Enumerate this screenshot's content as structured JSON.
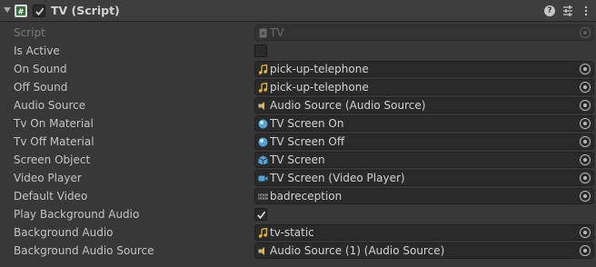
{
  "header": {
    "title": "TV (Script)",
    "enabled": true
  },
  "colors": {
    "panel_bg": "#383838",
    "field_bg": "#2a2a2a",
    "text": "#c4c4c4",
    "audio_clip_icon": "#e3b53d",
    "material_icon": "#4fa3d6"
  },
  "fields": [
    {
      "label": "Script",
      "type": "object",
      "value": "TV",
      "icon": "script-file-icon",
      "disabled": true
    },
    {
      "label": "Is Active",
      "type": "toggle",
      "checked": false
    },
    {
      "label": "On Sound",
      "type": "object",
      "value": "pick-up-telephone",
      "icon": "audio-clip-icon"
    },
    {
      "label": "Off Sound",
      "type": "object",
      "value": "pick-up-telephone",
      "icon": "audio-clip-icon"
    },
    {
      "label": "Audio Source",
      "type": "object",
      "value": "Audio Source (Audio Source)",
      "icon": "audio-source-icon"
    },
    {
      "label": "Tv On Material",
      "type": "object",
      "value": "TV Screen On",
      "icon": "material-icon"
    },
    {
      "label": "Tv Off Material",
      "type": "object",
      "value": "TV Screen Off",
      "icon": "material-icon"
    },
    {
      "label": "Screen Object",
      "type": "object",
      "value": "TV Screen",
      "icon": "game-object-icon"
    },
    {
      "label": "Video Player",
      "type": "object",
      "value": "TV Screen (Video Player)",
      "icon": "video-player-icon"
    },
    {
      "label": "Default Video",
      "type": "object",
      "value": "badreception",
      "icon": "video-clip-icon"
    },
    {
      "label": "Play Background Audio",
      "type": "toggle",
      "checked": true
    },
    {
      "label": "Background Audio",
      "type": "object",
      "value": "tv-static",
      "icon": "audio-clip-icon"
    },
    {
      "label": "Background Audio Source",
      "type": "object",
      "value": "Audio Source (1) (Audio Source)",
      "icon": "audio-source-icon"
    }
  ]
}
